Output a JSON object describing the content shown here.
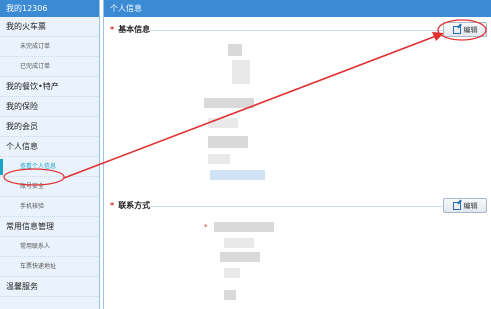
{
  "sidebar": {
    "header": "我的12306",
    "items": [
      {
        "label": "我的火车票",
        "level": 1
      },
      {
        "label": "未完成订单",
        "level": 2
      },
      {
        "label": "已完成订单",
        "level": 2
      },
      {
        "label": "我的餐饮•特产",
        "level": 1
      },
      {
        "label": "我的保险",
        "level": 1
      },
      {
        "label": "我的会员",
        "level": 1
      },
      {
        "label": "个人信息",
        "level": 1
      },
      {
        "label": "查看个人信息",
        "level": 2,
        "active": true
      },
      {
        "label": "账号安全",
        "level": 2
      },
      {
        "label": "手机核验",
        "level": 2
      },
      {
        "label": "常用信息管理",
        "level": 1
      },
      {
        "label": "常用联系人",
        "level": 2
      },
      {
        "label": "车票快递地址",
        "level": 2
      },
      {
        "label": "温馨服务",
        "level": 1
      }
    ]
  },
  "main": {
    "header": "个人信息",
    "basic_info": {
      "title": "基本信息",
      "edit_label": "编辑"
    },
    "contact": {
      "title": "联系方式",
      "edit_label": "编辑"
    }
  },
  "colors": {
    "header_blue": "#3a8ad4",
    "annotation_red": "#e03030",
    "active_teal": "#1aa3c9"
  },
  "icons": [
    "edit-icon"
  ]
}
